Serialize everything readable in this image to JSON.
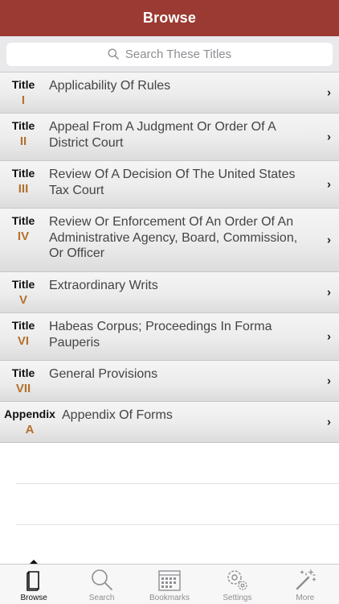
{
  "navbar": {
    "title": "Browse"
  },
  "search": {
    "placeholder": "Search These Titles"
  },
  "rows": [
    {
      "kind": "Title",
      "num": "I",
      "text": "Applicability Of Rules"
    },
    {
      "kind": "Title",
      "num": "II",
      "text": "Appeal From A Judgment Or Order Of A District Court"
    },
    {
      "kind": "Title",
      "num": "III",
      "text": "Review Of A Decision Of The United States Tax Court"
    },
    {
      "kind": "Title",
      "num": "IV",
      "text": "Review Or Enforcement Of An Order Of An Administrative Agency, Board, Commission, Or Officer"
    },
    {
      "kind": "Title",
      "num": "V",
      "text": "Extraordinary Writs"
    },
    {
      "kind": "Title",
      "num": "VI",
      "text": "Habeas Corpus; Proceedings In Forma Pauperis"
    },
    {
      "kind": "Title",
      "num": "VII",
      "text": "General Provisions"
    },
    {
      "kind": "Appendix",
      "num": "A",
      "text": "Appendix Of Forms"
    }
  ],
  "tabs": [
    {
      "label": "Browse",
      "icon": "book-icon",
      "active": true
    },
    {
      "label": "Search",
      "icon": "magnifier-icon",
      "active": false
    },
    {
      "label": "Bookmarks",
      "icon": "calendar-icon",
      "active": false
    },
    {
      "label": "Settings",
      "icon": "gear-icon",
      "active": false
    },
    {
      "label": "More",
      "icon": "magic-wand-icon",
      "active": false
    }
  ],
  "colors": {
    "navbar": "#9b3a32",
    "numeral": "#b5702d"
  }
}
